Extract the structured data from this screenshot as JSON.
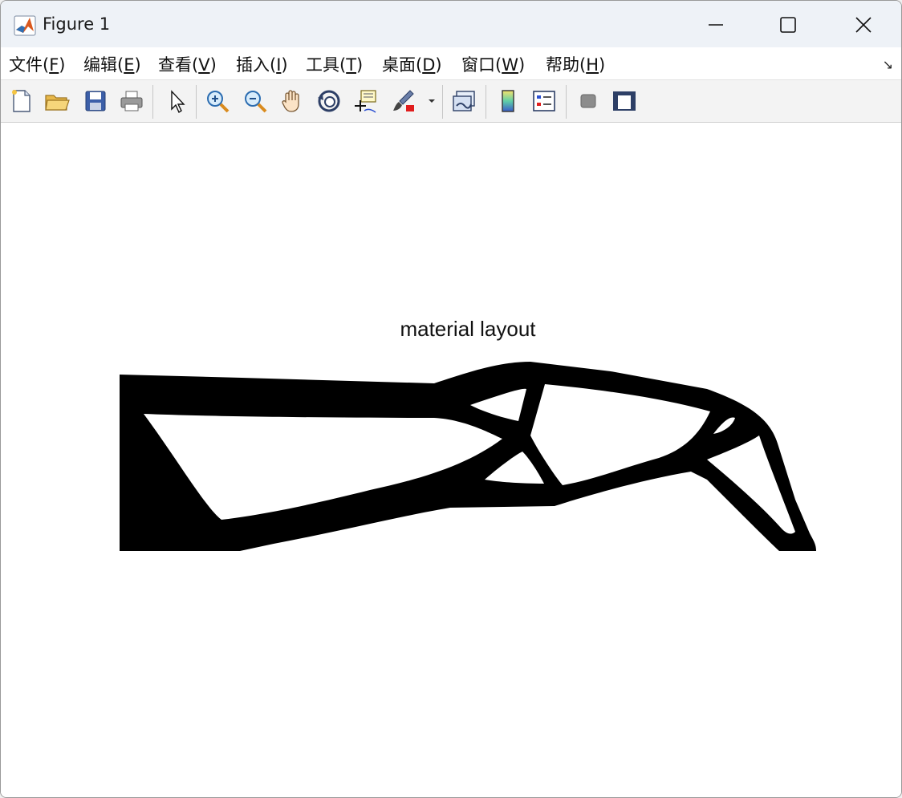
{
  "window": {
    "title": "Figure 1"
  },
  "window_controls": {
    "minimize": "minimize",
    "maximize": "maximize",
    "close": "close"
  },
  "menubar": {
    "items": [
      {
        "label": "文件(",
        "key": "F",
        "tail": ")"
      },
      {
        "label": "编辑(",
        "key": "E",
        "tail": ")"
      },
      {
        "label": "查看(",
        "key": "V",
        "tail": ")"
      },
      {
        "label": "插入(",
        "key": "I",
        "tail": ")"
      },
      {
        "label": "工具(",
        "key": "T",
        "tail": ")"
      },
      {
        "label": "桌面(",
        "key": "D",
        "tail": ")"
      },
      {
        "label": "窗口(",
        "key": "W",
        "tail": ")"
      },
      {
        "label": "帮助(",
        "key": "H",
        "tail": ")"
      }
    ],
    "dock_glyph": "↘"
  },
  "toolbar": {
    "icons": [
      "new-figure-icon",
      "open-file-icon",
      "save-icon",
      "print-icon",
      "edit-plot-arrow-icon",
      "zoom-in-icon",
      "zoom-out-icon",
      "pan-hand-icon",
      "rotate-3d-icon",
      "data-cursor-icon",
      "brush-icon",
      "brush-dropdown-icon",
      "link-plot-icon",
      "colorbar-icon",
      "legend-icon",
      "hide-plot-tools-icon",
      "show-plot-tools-icon"
    ]
  },
  "plot": {
    "title": "material layout",
    "fill_color": "#000000",
    "background_color": "#ffffff"
  }
}
